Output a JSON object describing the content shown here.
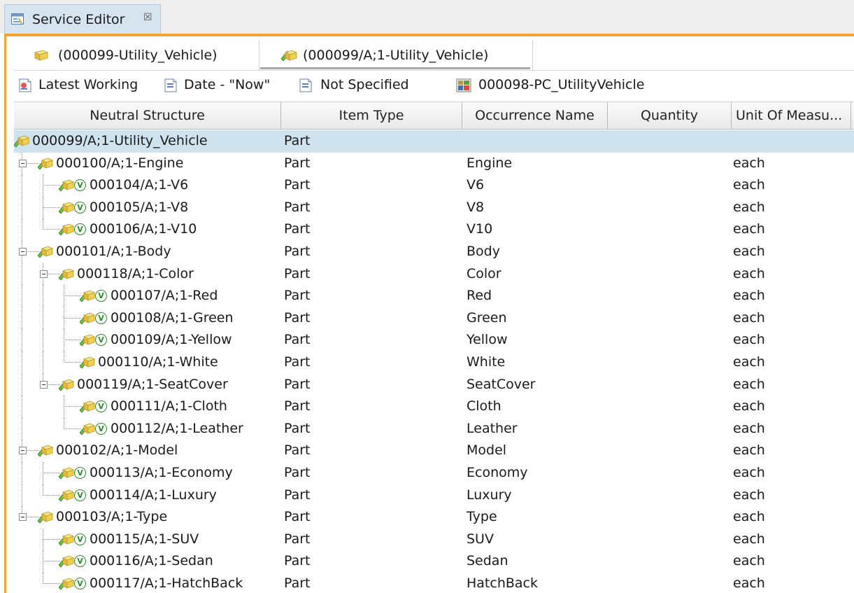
{
  "view_tab": {
    "title": "Service Editor",
    "close_symbol": "☒"
  },
  "editor_tabs": [
    {
      "label": "(000099-Utility_Vehicle)"
    },
    {
      "label": "(000099/A;1-Utility_Vehicle)"
    }
  ],
  "rule_bar": {
    "items": [
      {
        "label": "Latest Working",
        "icon": "revision-rule-icon"
      },
      {
        "label": "Date - \"Now\"",
        "icon": "revision-rule-icon"
      },
      {
        "label": "Not Specified",
        "icon": "revision-rule-icon"
      },
      {
        "label": "000098-PC_UtilityVehicle",
        "icon": "product-context-icon"
      }
    ]
  },
  "columns": {
    "structure": "Neutral Structure",
    "item_type": "Item Type",
    "occurrence": "Occurrence Name",
    "quantity": "Quantity",
    "uom": "Unit Of Measu..."
  },
  "rows": [
    {
      "name": "000099/A;1-Utility_Vehicle",
      "type": "Part",
      "occ": "",
      "uom": "",
      "variant": false
    },
    {
      "name": "000100/A;1-Engine",
      "type": "Part",
      "occ": "Engine",
      "uom": "each",
      "variant": false
    },
    {
      "name": "000104/A;1-V6",
      "type": "Part",
      "occ": "V6",
      "uom": "each",
      "variant": true
    },
    {
      "name": "000105/A;1-V8",
      "type": "Part",
      "occ": "V8",
      "uom": "each",
      "variant": true
    },
    {
      "name": "000106/A;1-V10",
      "type": "Part",
      "occ": "V10",
      "uom": "each",
      "variant": true
    },
    {
      "name": "000101/A;1-Body",
      "type": "Part",
      "occ": "Body",
      "uom": "each",
      "variant": false
    },
    {
      "name": "000118/A;1-Color",
      "type": "Part",
      "occ": "Color",
      "uom": "each",
      "variant": false
    },
    {
      "name": "000107/A;1-Red",
      "type": "Part",
      "occ": "Red",
      "uom": "each",
      "variant": true
    },
    {
      "name": "000108/A;1-Green",
      "type": "Part",
      "occ": "Green",
      "uom": "each",
      "variant": true
    },
    {
      "name": "000109/A;1-Yellow",
      "type": "Part",
      "occ": "Yellow",
      "uom": "each",
      "variant": true
    },
    {
      "name": "000110/A;1-White",
      "type": "Part",
      "occ": "White",
      "uom": "each",
      "variant": false
    },
    {
      "name": "000119/A;1-SeatCover",
      "type": "Part",
      "occ": "SeatCover",
      "uom": "each",
      "variant": false
    },
    {
      "name": "000111/A;1-Cloth",
      "type": "Part",
      "occ": "Cloth",
      "uom": "each",
      "variant": true
    },
    {
      "name": "000112/A;1-Leather",
      "type": "Part",
      "occ": "Leather",
      "uom": "each",
      "variant": true
    },
    {
      "name": "000102/A;1-Model",
      "type": "Part",
      "occ": "Model",
      "uom": "each",
      "variant": false
    },
    {
      "name": "000113/A;1-Economy",
      "type": "Part",
      "occ": "Economy",
      "uom": "each",
      "variant": true
    },
    {
      "name": "000114/A;1-Luxury",
      "type": "Part",
      "occ": "Luxury",
      "uom": "each",
      "variant": true
    },
    {
      "name": "000103/A;1-Type",
      "type": "Part",
      "occ": "Type",
      "uom": "each",
      "variant": false
    },
    {
      "name": "000115/A;1-SUV",
      "type": "Part",
      "occ": "SUV",
      "uom": "each",
      "variant": true
    },
    {
      "name": "000116/A;1-Sedan",
      "type": "Part",
      "occ": "Sedan",
      "uom": "each",
      "variant": true
    },
    {
      "name": "000117/A;1-HatchBack",
      "type": "Part",
      "occ": "HatchBack",
      "uom": "each",
      "variant": true
    }
  ],
  "variant_glyph": "V",
  "colors": {
    "selection": "#cfe3ee",
    "view_accent": "#f4a432",
    "tab_active": "#d6e4f0",
    "variant": "#2e8b2e"
  }
}
